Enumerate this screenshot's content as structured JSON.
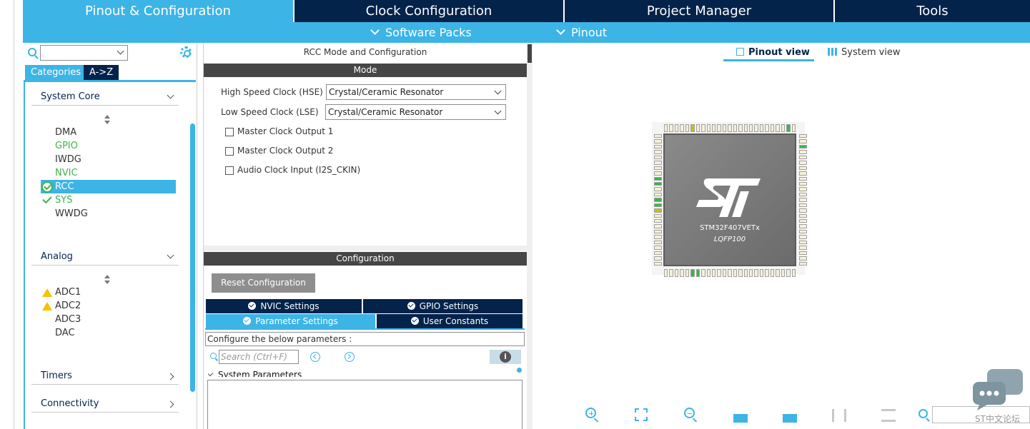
{
  "top_tabs": [
    "Pinout & Configuration",
    "Clock Configuration",
    "Project Manager",
    "Tools"
  ],
  "sub_menu": [
    "Software Packs",
    "Pinout"
  ],
  "categories": {
    "tabs": [
      "Categories",
      "A->Z"
    ],
    "groups": [
      {
        "name": "System Core",
        "items": [
          "DMA",
          "GPIO",
          "IWDG",
          "NVIC",
          "RCC",
          "SYS",
          "WWDG"
        ]
      },
      {
        "name": "Analog",
        "items": [
          "ADC1",
          "ADC2",
          "ADC3",
          "DAC"
        ]
      },
      {
        "name": "Timers"
      },
      {
        "name": "Connectivity"
      }
    ],
    "selected": "RCC"
  },
  "mode": {
    "panel_title": "RCC Mode and Configuration",
    "section_mode": "Mode",
    "hse_label": "High Speed Clock (HSE)",
    "hse_value": "Crystal/Ceramic Resonator",
    "lse_label": "Low Speed Clock (LSE)",
    "lse_value": "Crystal/Ceramic Resonator",
    "checkboxes": [
      "Master Clock Output 1",
      "Master Clock Output 2",
      "Audio Clock Input (I2S_CKIN)"
    ]
  },
  "config": {
    "section": "Configuration",
    "reset": "Reset Configuration",
    "tabs": [
      "NVIC Settings",
      "GPIO Settings",
      "Parameter Settings",
      "User Constants"
    ],
    "hint": "Configure the below parameters :",
    "search_placeholder": "Search (Ctrl+F)",
    "group": "System Parameters"
  },
  "pinout": {
    "view_tabs": [
      "Pinout view",
      "System view"
    ],
    "chip_name": "STM32F407VETx",
    "package": "LQFP100"
  },
  "forum_label": "ST中文论坛",
  "colors": {
    "navy": "#03234b",
    "accent": "#3cb4e6",
    "green": "#3cb44a",
    "warning": "#f7c200"
  }
}
